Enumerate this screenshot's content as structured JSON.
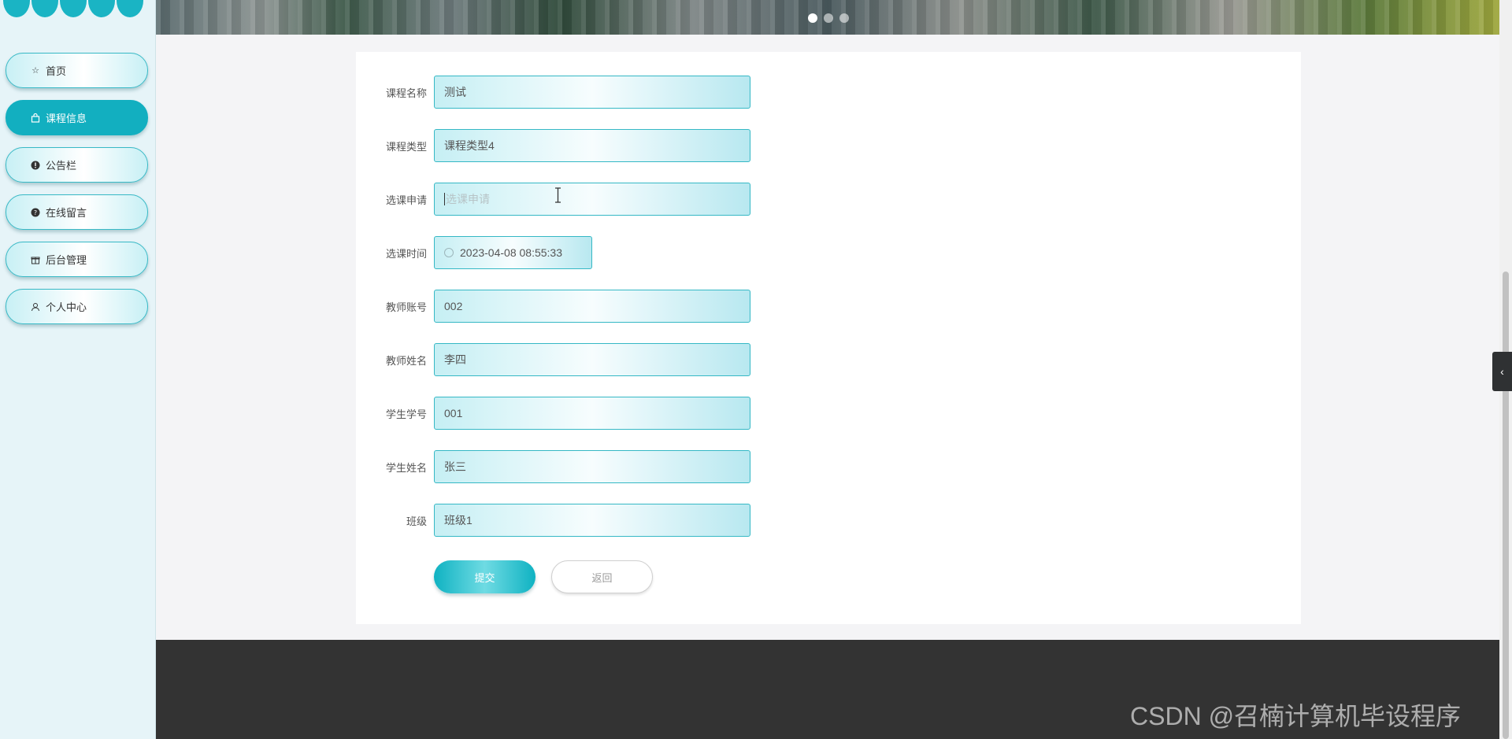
{
  "sidebar": {
    "items": [
      {
        "label": "首页",
        "icon": "star-icon",
        "active": false
      },
      {
        "label": "课程信息",
        "icon": "bag-icon",
        "active": true
      },
      {
        "label": "公告栏",
        "icon": "exclamation-icon",
        "active": false
      },
      {
        "label": "在线留言",
        "icon": "question-icon",
        "active": false
      },
      {
        "label": "后台管理",
        "icon": "gift-icon",
        "active": false
      },
      {
        "label": "个人中心",
        "icon": "user-icon",
        "active": false
      }
    ]
  },
  "form": {
    "course_name": {
      "label": "课程名称",
      "value": "测试"
    },
    "course_type": {
      "label": "课程类型",
      "value": "课程类型4"
    },
    "application": {
      "label": "选课申请",
      "placeholder": "选课申请"
    },
    "select_time": {
      "label": "选课时间",
      "value": "2023-04-08 08:55:33"
    },
    "teacher_account": {
      "label": "教师账号",
      "value": "002"
    },
    "teacher_name": {
      "label": "教师姓名",
      "value": "李四"
    },
    "student_id": {
      "label": "学生学号",
      "value": "001"
    },
    "student_name": {
      "label": "学生姓名",
      "value": "张三"
    },
    "class_name": {
      "label": "班级",
      "value": "班级1"
    },
    "submit_label": "提交",
    "back_label": "返回"
  },
  "banner": {
    "slide_count": 3,
    "active_slide": 1
  },
  "watermark": "CSDN @召楠计算机毕设程序",
  "colors": {
    "accent": "#12afc0",
    "footer": "#333333",
    "sidebar_bg": "#e6f4f8"
  }
}
